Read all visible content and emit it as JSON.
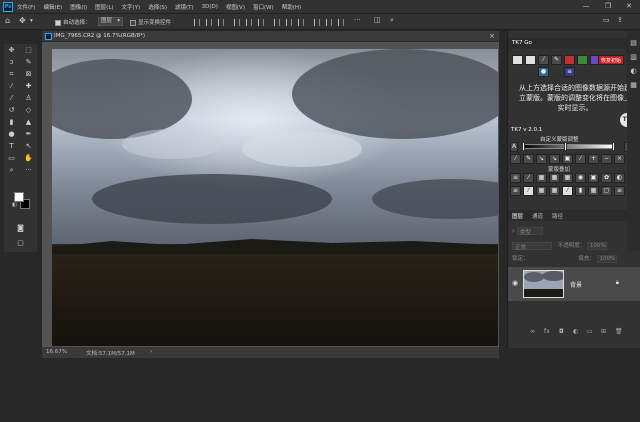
{
  "app": {
    "logo": "Ps"
  },
  "menu": [
    "文件(F)",
    "编辑(E)",
    "图像(I)",
    "图层(L)",
    "文字(Y)",
    "选择(S)",
    "滤镜(T)",
    "3D(D)",
    "视图(V)",
    "窗口(W)",
    "帮助(H)"
  ],
  "window_controls": {
    "minimize": "—",
    "maximize": "❐",
    "close": "✕"
  },
  "options": {
    "auto_select_label": "自动选择：",
    "auto_select_value": "图层",
    "transform_label": "显示变换控件"
  },
  "document": {
    "title": "IMG_7965.CR2 @ 16.7%(RGB/8*)",
    "close": "×",
    "zoom": "16.67%",
    "doc_size": "文档:57.1M/57.1M",
    "nav_arrow": "›"
  },
  "panels": {
    "tk7_tab": "TK7 Go",
    "tk7_top_btn": "恢复初始",
    "tk7_message": "从上方选择合适的图像数据源开始建立蒙版。蒙版的调整变化将在图像上实时显示。",
    "tk7_badge": "TK",
    "tk7_version": "TK7 v 2.0.1",
    "tk7_adjust_label": "自定义蒙版调整",
    "tk7_mask_label": "蒙版叠加",
    "tk7_a_label": "A",
    "tk7_lm_label": "LM",
    "layers_tab": "图层",
    "channels_tab": "通道",
    "paths_tab": "路径",
    "layer_filter": "类型",
    "blend_mode": "正常",
    "opacity_label": "不透明度：",
    "opacity_value": "100%",
    "lock_label": "锁定：",
    "fill_label": "填充：",
    "fill_value": "100%",
    "background_layer": "背景"
  },
  "colors": {
    "foreground": "#ffffff",
    "background": "#000000",
    "accent": "#31a8ff"
  }
}
